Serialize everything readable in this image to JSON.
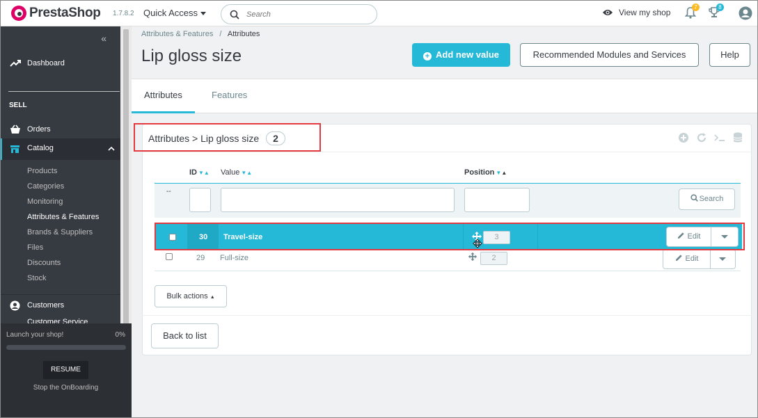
{
  "header": {
    "brand": "PrestaShop",
    "version": "1.7.8.2",
    "quick_access": "Quick Access",
    "search_placeholder": "Search",
    "view_shop": "View my shop",
    "notifications_orders": "7",
    "notifications_customers": "8"
  },
  "sidebar": {
    "dashboard": "Dashboard",
    "section_sell": "SELL",
    "orders": "Orders",
    "catalog": "Catalog",
    "catalog_items": [
      "Products",
      "Categories",
      "Monitoring",
      "Attributes & Features",
      "Brands & Suppliers",
      "Files",
      "Discounts",
      "Stock"
    ],
    "customers": "Customers",
    "customer_service": "Customer Service"
  },
  "onboarding": {
    "launch": "Launch your shop!",
    "percent": "0%",
    "progress": 0,
    "resume": "RESUME",
    "stop": "Stop the OnBoarding"
  },
  "breadcrumb": {
    "parent": "Attributes & Features",
    "separator": "/",
    "current": "Attributes"
  },
  "page": {
    "title": "Lip gloss size",
    "add_button": "Add new value",
    "recommended_button": "Recommended Modules and Services",
    "help_button": "Help"
  },
  "tabs": [
    "Attributes",
    "Features"
  ],
  "panel": {
    "title": "Attributes > Lip gloss size",
    "count": "2"
  },
  "table": {
    "columns": {
      "id": "ID",
      "value": "Value",
      "position": "Position"
    },
    "filter_placeholder": "--",
    "search_button": "Search",
    "rows": [
      {
        "id": "30",
        "value": "Travel-size",
        "position": "3",
        "edit": "Edit"
      },
      {
        "id": "29",
        "value": "Full-size",
        "position": "2",
        "edit": "Edit"
      }
    ],
    "bulk_actions": "Bulk actions"
  },
  "footer": {
    "back_to_list": "Back to list"
  },
  "colors": {
    "accent": "#25b9d7",
    "sidebar": "#363a41",
    "highlight_box": "#e4393e"
  }
}
